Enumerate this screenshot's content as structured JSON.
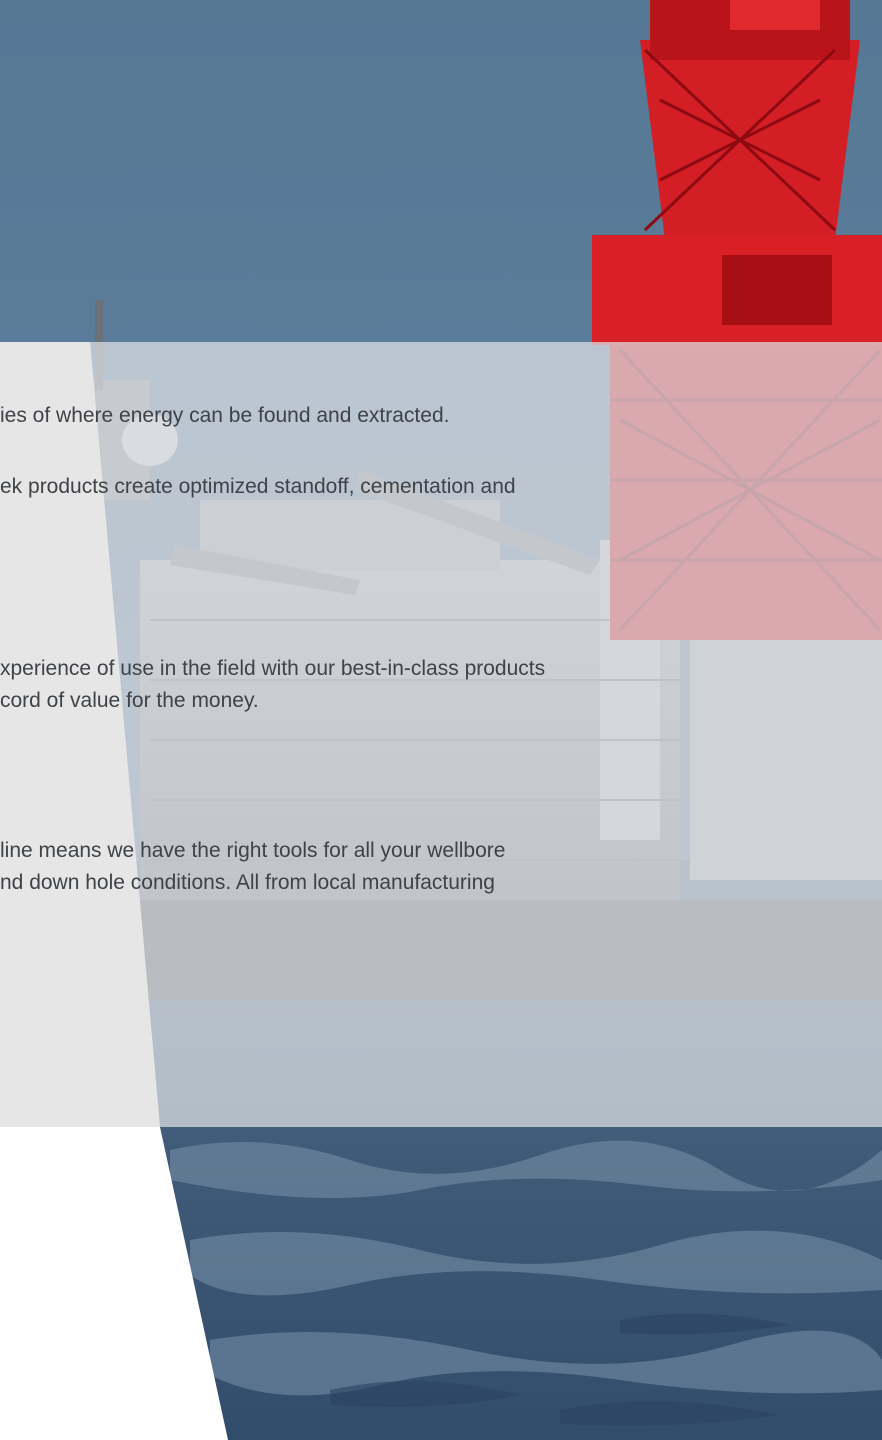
{
  "content": {
    "lines": [
      "ies of where energy can be found and extracted.",
      "ek products create optimized standoff, cementation and",
      "xperience of use in the field with our best-in-class products",
      "cord of value for the money.",
      "line means we have the right tools for all your wellbore",
      "nd down hole conditions. All from local manufacturing"
    ]
  },
  "colors": {
    "sky": "#5b7d9b",
    "sea": "#3f5f7e",
    "panel": "#dfe2e6",
    "derrick_red": "#d21e24",
    "text": "#3f4347"
  },
  "icons": {
    "ship": "drill-ship-icon",
    "derrick": "drilling-derrick-icon",
    "waves": "sea-waves-icon"
  }
}
